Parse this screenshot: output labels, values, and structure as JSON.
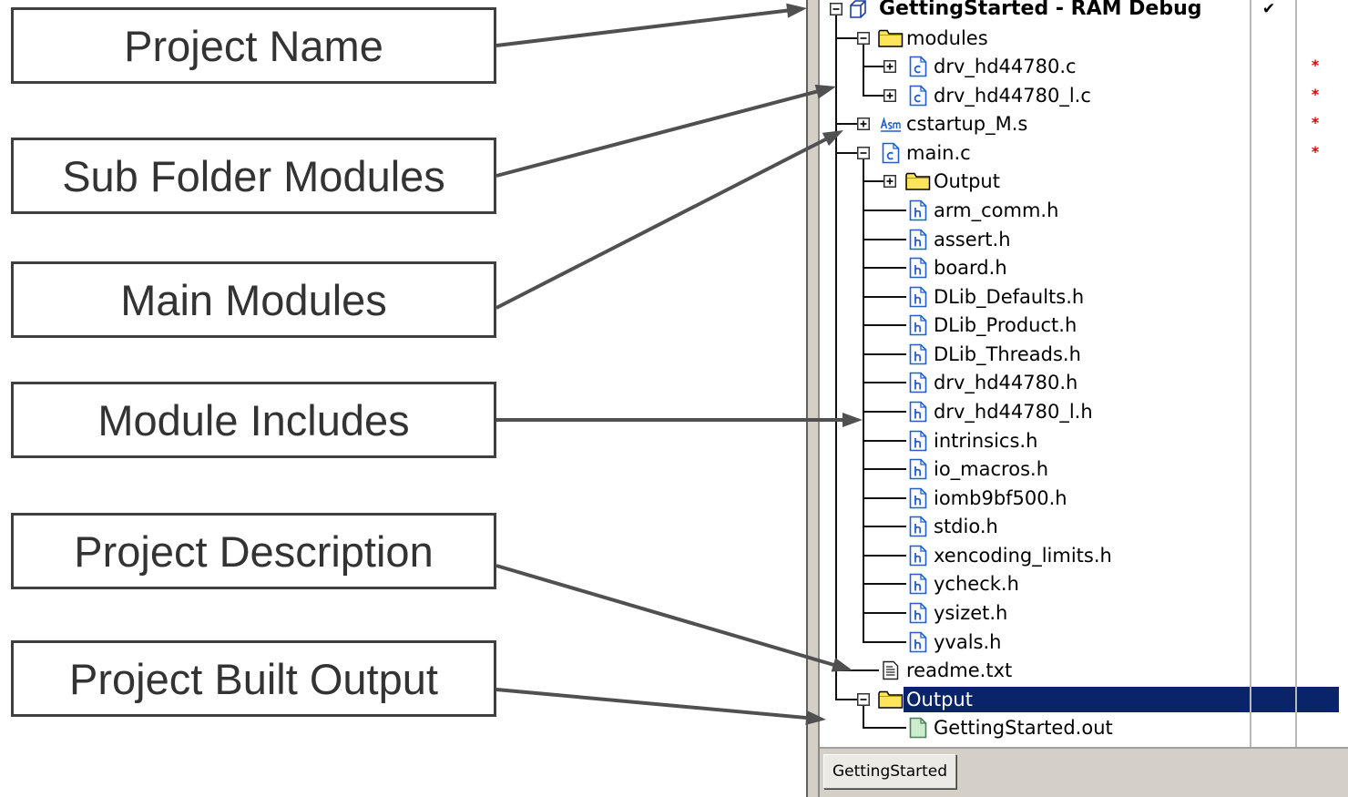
{
  "annotations": [
    "Project Name",
    "Sub Folder Modules",
    "Main Modules",
    "Module Includes",
    "Project Description",
    "Project Built Output"
  ],
  "workspace": {
    "tree": {
      "label": "GettingStarted - RAM Debug",
      "icon": "project-icon",
      "expanded": true,
      "check": "✔",
      "children": [
        {
          "label": "modules",
          "icon": "folder-icon",
          "expanded": true,
          "children": [
            {
              "label": "drv_hd44780.c",
              "icon": "c-file-icon",
              "expanded": false,
              "modified": "*"
            },
            {
              "label": "drv_hd44780_l.c",
              "icon": "c-file-icon",
              "expanded": false,
              "modified": "*"
            }
          ]
        },
        {
          "label": "cstartup_M.s",
          "icon": "asm-file-icon",
          "expanded": false,
          "modified": "*"
        },
        {
          "label": "main.c",
          "icon": "c-file-icon",
          "expanded": true,
          "modified": "*",
          "children": [
            {
              "label": "Output",
              "icon": "folder-icon",
              "expanded": false
            },
            {
              "label": "arm_comm.h",
              "icon": "h-file-icon"
            },
            {
              "label": "assert.h",
              "icon": "h-file-icon"
            },
            {
              "label": "board.h",
              "icon": "h-file-icon"
            },
            {
              "label": "DLib_Defaults.h",
              "icon": "h-file-icon"
            },
            {
              "label": "DLib_Product.h",
              "icon": "h-file-icon"
            },
            {
              "label": "DLib_Threads.h",
              "icon": "h-file-icon"
            },
            {
              "label": "drv_hd44780.h",
              "icon": "h-file-icon"
            },
            {
              "label": "drv_hd44780_l.h",
              "icon": "h-file-icon"
            },
            {
              "label": "intrinsics.h",
              "icon": "h-file-icon"
            },
            {
              "label": "io_macros.h",
              "icon": "h-file-icon"
            },
            {
              "label": "iomb9bf500.h",
              "icon": "h-file-icon"
            },
            {
              "label": "stdio.h",
              "icon": "h-file-icon"
            },
            {
              "label": "xencoding_limits.h",
              "icon": "h-file-icon"
            },
            {
              "label": "ycheck.h",
              "icon": "h-file-icon"
            },
            {
              "label": "ysizet.h",
              "icon": "h-file-icon"
            },
            {
              "label": "yvals.h",
              "icon": "h-file-icon"
            }
          ]
        },
        {
          "label": "readme.txt",
          "icon": "text-file-icon"
        },
        {
          "label": "Output",
          "icon": "folder-icon",
          "expanded": true,
          "selected": true,
          "children": [
            {
              "label": "GettingStarted.out",
              "icon": "output-file-icon"
            }
          ]
        }
      ]
    },
    "tabs": [
      {
        "label": "GettingStarted",
        "active": true
      }
    ]
  },
  "colors": {
    "selection": "#0a246a",
    "selection_text": "#ffffff",
    "modified_marker": "#e00000",
    "arrow": "#505050",
    "annotation_text": "#333333",
    "panel_face": "#d4d0c8"
  }
}
